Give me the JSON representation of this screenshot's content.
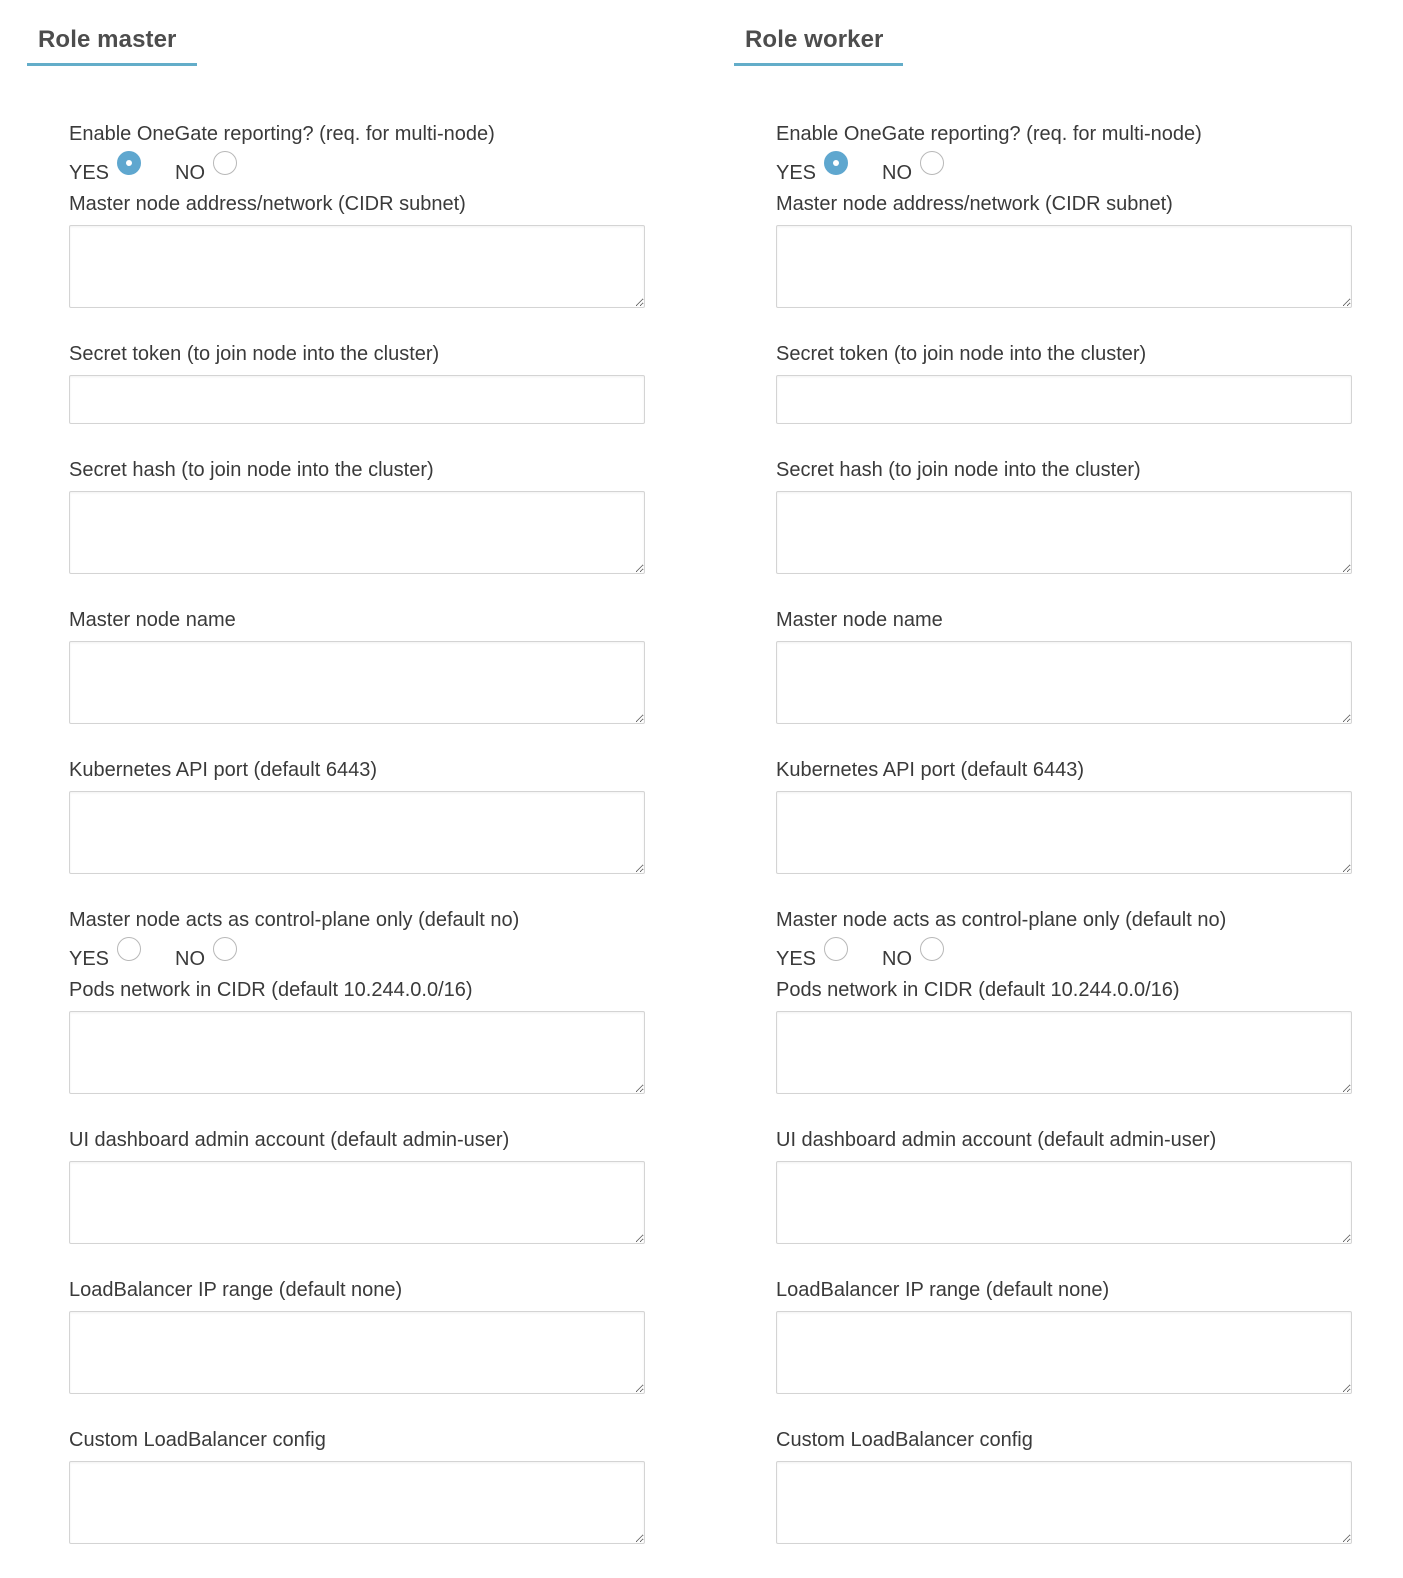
{
  "master": {
    "title": "Role master",
    "onegate": {
      "label": "Enable OneGate reporting? (req. for multi-node)",
      "yes": "YES",
      "no": "NO",
      "selected": "yes"
    },
    "master_address_label": "Master node address/network (CIDR subnet)",
    "secret_token_label": "Secret token (to join node into the cluster)",
    "secret_hash_label": "Secret hash (to join node into the cluster)",
    "master_node_name_label": "Master node name",
    "api_port_label": "Kubernetes API port (default 6443)",
    "control_plane": {
      "label": "Master node acts as control-plane only (default no)",
      "yes": "YES",
      "no": "NO",
      "selected": "none"
    },
    "pods_network_label": "Pods network in CIDR (default 10.244.0.0/16)",
    "dashboard_admin_label": "UI dashboard admin account (default admin-user)",
    "lb_ip_range_label": "LoadBalancer IP range (default none)",
    "custom_lb_label": "Custom LoadBalancer config"
  },
  "worker": {
    "title": "Role worker",
    "onegate": {
      "label": "Enable OneGate reporting? (req. for multi-node)",
      "yes": "YES",
      "no": "NO",
      "selected": "yes"
    },
    "master_address_label": "Master node address/network (CIDR subnet)",
    "secret_token_label": "Secret token (to join node into the cluster)",
    "secret_hash_label": "Secret hash (to join node into the cluster)",
    "master_node_name_label": "Master node name",
    "api_port_label": "Kubernetes API port (default 6443)",
    "control_plane": {
      "label": "Master node acts as control-plane only (default no)",
      "yes": "YES",
      "no": "NO",
      "selected": "none"
    },
    "pods_network_label": "Pods network in CIDR (default 10.244.0.0/16)",
    "dashboard_admin_label": "UI dashboard admin account (default admin-user)",
    "lb_ip_range_label": "LoadBalancer IP range (default none)",
    "custom_lb_label": "Custom LoadBalancer config"
  },
  "colors": {
    "accent": "#63adc9",
    "radio_checked": "#5fa7cf",
    "text": "#3a3a3a",
    "title": "#4d4d4d",
    "input_border": "#d4d4d4"
  }
}
